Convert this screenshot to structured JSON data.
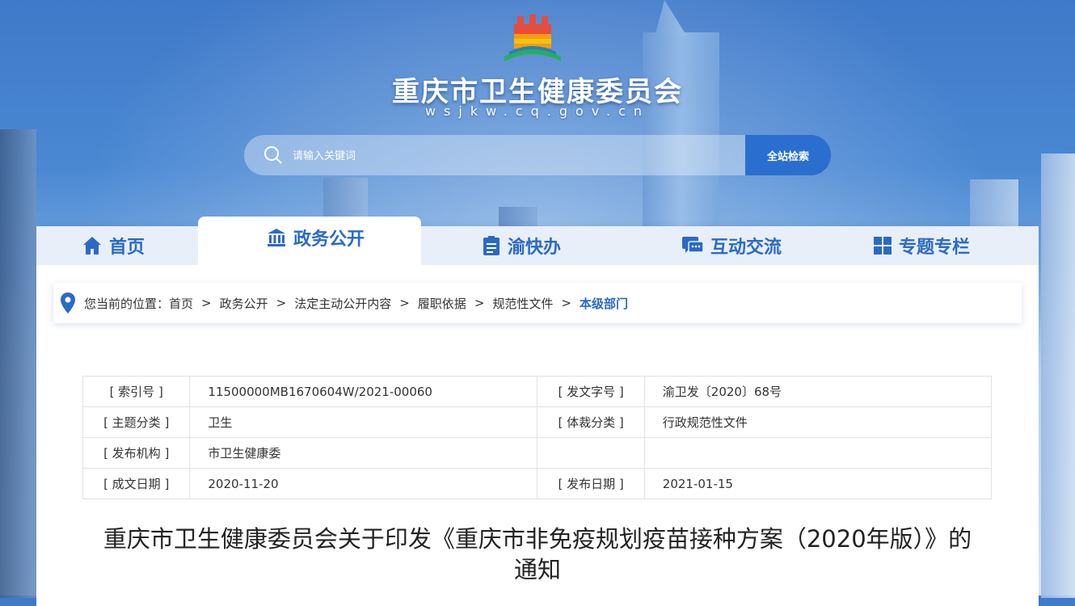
{
  "site": {
    "title": "重庆市卫生健康委员会",
    "domain": "wsjkw.cq.gov.cn"
  },
  "search": {
    "placeholder": "请输入关键词",
    "button_label": "全站检索"
  },
  "nav": {
    "tabs": [
      {
        "label": "首页",
        "icon": "home-icon"
      },
      {
        "label": "政务公开",
        "icon": "government-building-icon",
        "active": true
      },
      {
        "label": "渝快办",
        "icon": "clipboard-icon"
      },
      {
        "label": "互动交流",
        "icon": "chat-icon"
      },
      {
        "label": "专题专栏",
        "icon": "grid-icon"
      }
    ]
  },
  "breadcrumb": {
    "prefix": "您当前的位置：",
    "items": [
      "首页",
      "政务公开",
      "法定主动公开内容",
      "履职依据",
      "规范性文件"
    ],
    "current": "本级部门",
    "separator": ">"
  },
  "meta": {
    "rows": [
      [
        {
          "k": "[ 索引号 ]",
          "v": "11500000MB1670604W/2021-00060"
        },
        {
          "k": "[ 发文字号 ]",
          "v": "渝卫发〔2020〕68号"
        }
      ],
      [
        {
          "k": "[ 主题分类 ]",
          "v": "卫生"
        },
        {
          "k": "[ 体裁分类 ]",
          "v": "行政规范性文件"
        }
      ],
      [
        {
          "k": "[ 发布机构 ]",
          "v": "市卫生健康委"
        },
        {
          "k": "",
          "v": ""
        }
      ],
      [
        {
          "k": "[ 成文日期 ]",
          "v": "2020-11-20"
        },
        {
          "k": "[ 发布日期 ]",
          "v": "2021-01-15"
        }
      ]
    ]
  },
  "document": {
    "title_line1": "重庆市卫生健康委员会关于印发《重庆市非免疫规划疫苗接种方案（2020年版）》的",
    "title_line2": "通知"
  },
  "colors": {
    "accent": "#2b6ac4",
    "search_button": "#2a6fcf"
  }
}
